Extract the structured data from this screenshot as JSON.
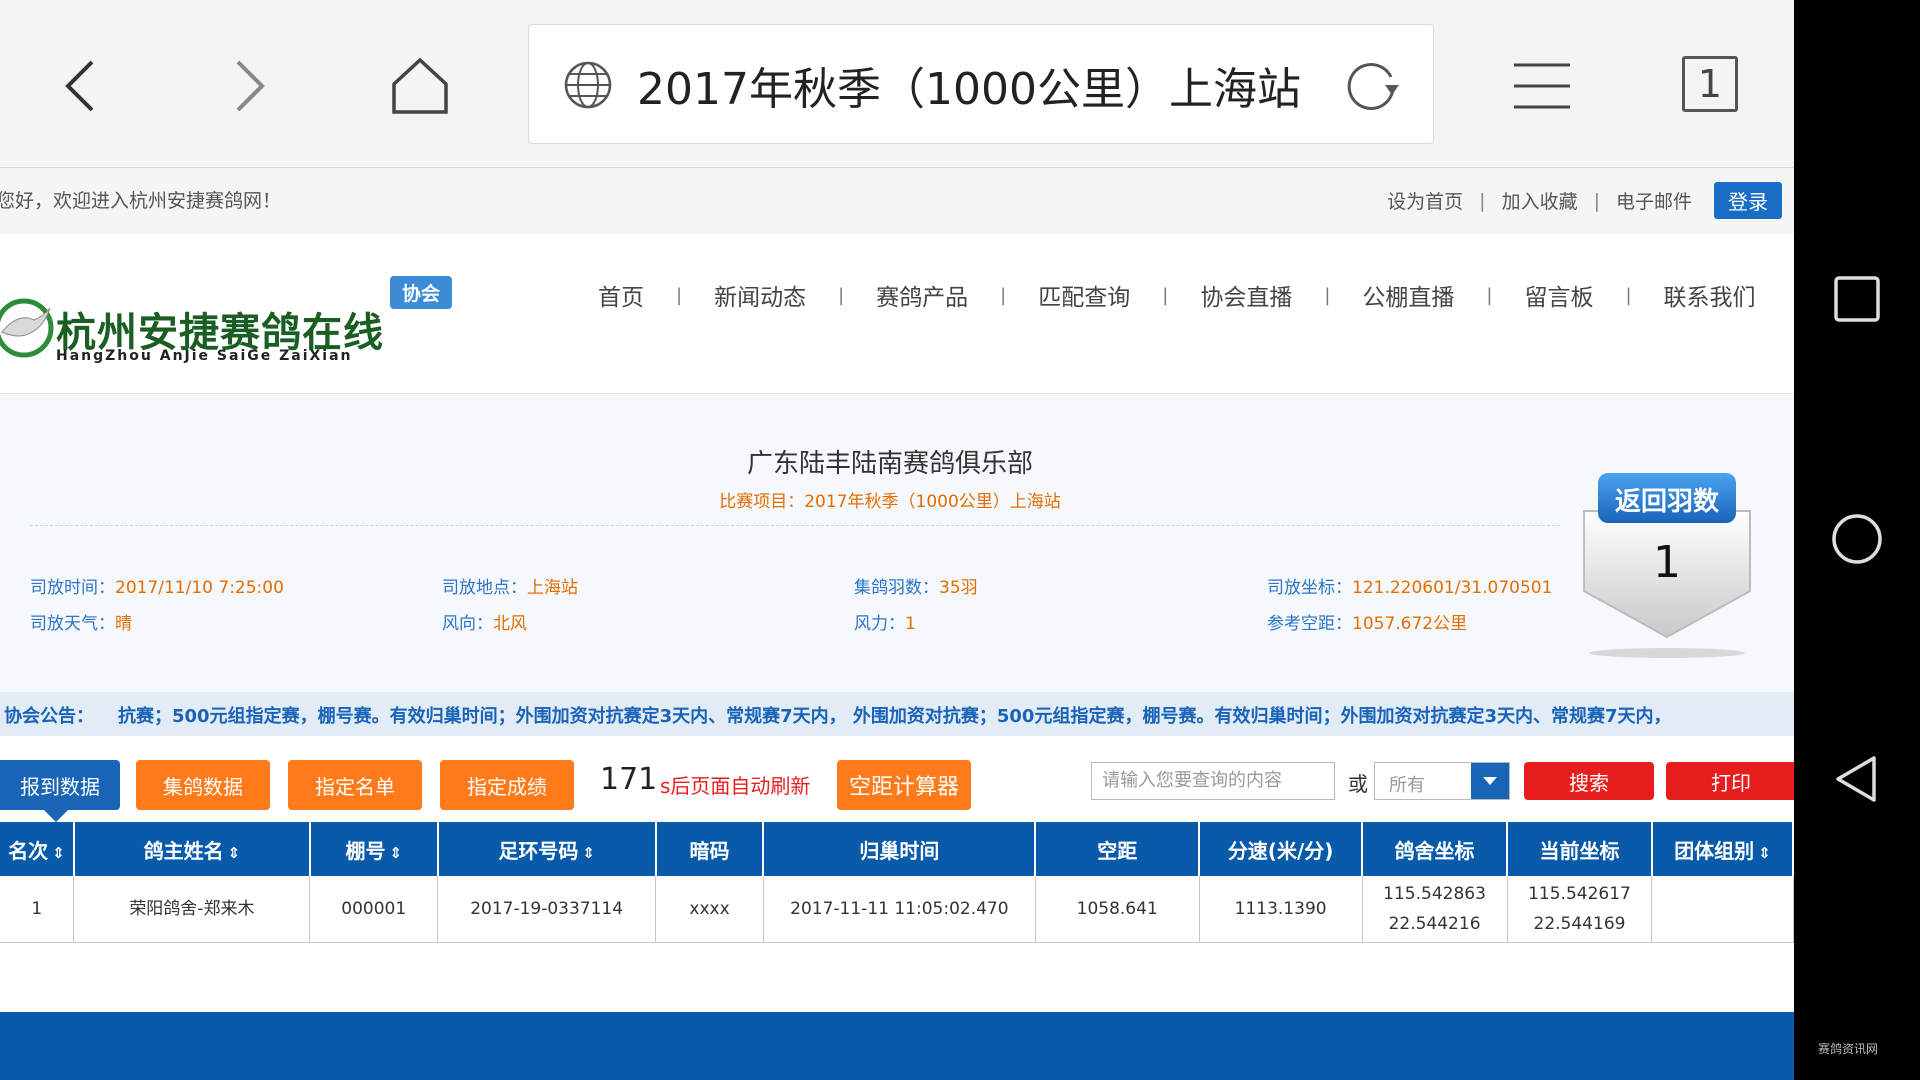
{
  "browser": {
    "url_title": "2017年秋季（1000公里）上海站",
    "tab_count": "1"
  },
  "topbar": {
    "welcome": "您好，欢迎进入杭州安捷赛鸽网！",
    "links": [
      "设为首页",
      "加入收藏",
      "电子邮件"
    ],
    "login": "登录"
  },
  "logo": {
    "badge": "协会",
    "text": "杭州安捷赛鸽在线",
    "sub": "HangZhou AnJie SaiGe ZaiXian"
  },
  "nav": [
    "首页",
    "新闻动态",
    "赛鸽产品",
    "匹配查询",
    "协会直播",
    "公棚直播",
    "留言板",
    "联系我们"
  ],
  "race": {
    "club": "广东陆丰陆南赛鸽俱乐部",
    "event_label": "比赛项目：",
    "event_value": "2017年秋季（1000公里）上海站",
    "release_time_label": "司放时间：",
    "release_time": "2017/11/10 7:25:00",
    "release_place_label": "司放地点：",
    "release_place": "上海站",
    "pigeon_count_label": "集鸽羽数：",
    "pigeon_count": "35羽",
    "release_coord_label": "司放坐标：",
    "release_coord": "121.220601/31.070501",
    "weather_label": "司放天气：",
    "weather": "晴",
    "wind_dir_label": "风向：",
    "wind_dir": "北风",
    "wind_power_label": "风力：",
    "wind_power": "1",
    "ref_distance_label": "参考空距：",
    "ref_distance": "1057.672公里",
    "return_badge_title": "返回羽数",
    "return_count": "1"
  },
  "announcement": {
    "label": "协会公告：",
    "text": "抗赛；500元组指定赛，棚号赛。有效归巢时间；外围加资对抗赛定3天内、常规赛7天内，  外围加资对抗赛；500元组指定赛，棚号赛。有效归巢时间；外围加资对抗赛定3天内、常规赛7天内，"
  },
  "toolbar": {
    "tab_report": "报到数据",
    "btn_collect": "集鸽数据",
    "btn_designated_list": "指定名单",
    "btn_designated_result": "指定成绩",
    "countdown": "171",
    "countdown_text": "s后页面自动刷新",
    "btn_calc": "空距计算器",
    "search_placeholder": "请输入您要查询的内容",
    "or": "或",
    "select_value": "所有",
    "btn_search": "搜索",
    "btn_print": "打印"
  },
  "table": {
    "headers": [
      "名次",
      "鸽主姓名",
      "棚号",
      "足环号码",
      "暗码",
      "归巢时间",
      "空距",
      "分速(米/分)",
      "鸽舍坐标",
      "当前坐标",
      "团体组别"
    ],
    "rows": [
      {
        "rank": "1",
        "owner": "荣阳鸽舍-郑来木",
        "loft": "000001",
        "ring": "2017-19-0337114",
        "code": "xxxx",
        "time": "2017-11-11 11:05:02.470",
        "distance": "1058.641",
        "speed": "1113.1390",
        "loft_coord_1": "115.542863",
        "loft_coord_2": "22.544216",
        "cur_coord_1": "115.542617",
        "cur_coord_2": "22.544169",
        "group": ""
      }
    ]
  },
  "watermark": "赛鸽资讯网",
  "colors": {
    "primary_blue": "#0a5aaa",
    "orange": "#ff7a1a",
    "red": "#e81e1e",
    "label_blue": "#2e74c6",
    "value_orange": "#e56d00"
  }
}
